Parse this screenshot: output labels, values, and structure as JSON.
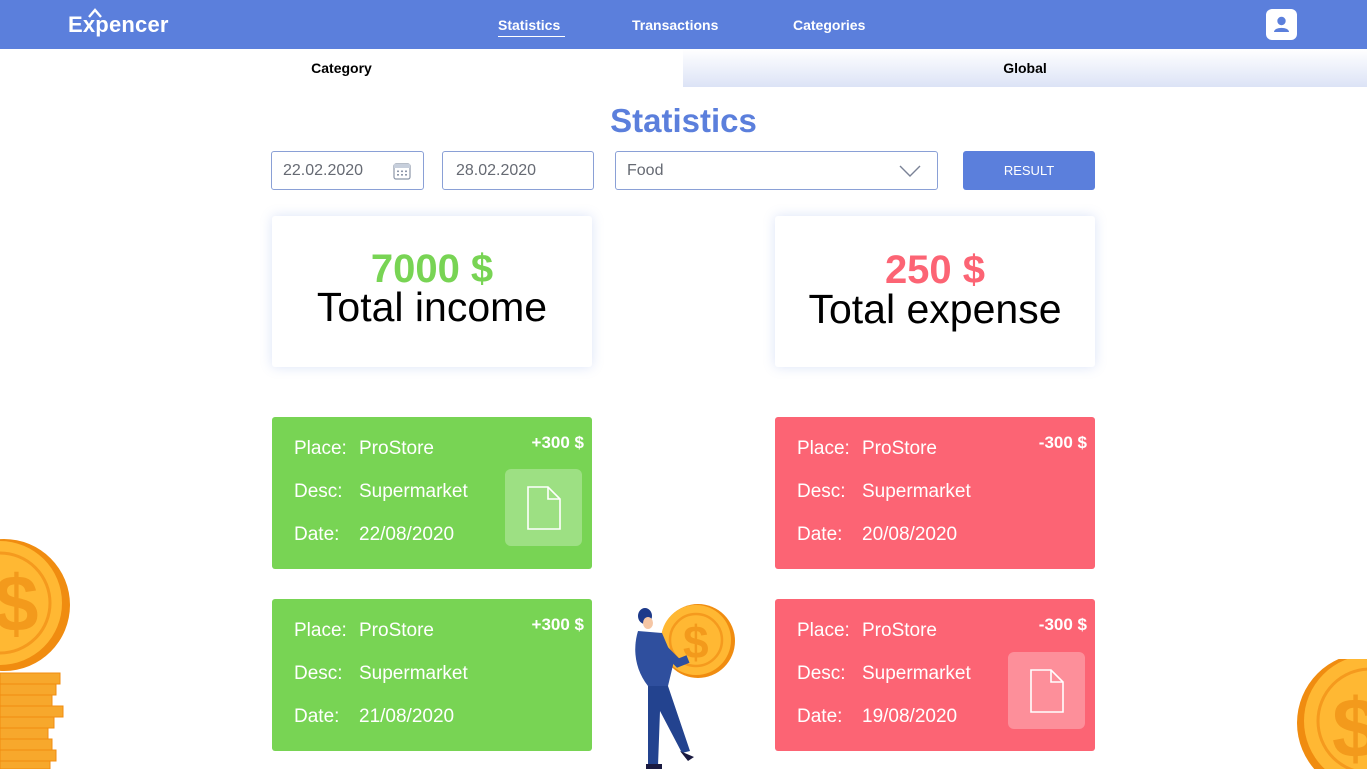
{
  "app": {
    "logo": "Expencer"
  },
  "nav": {
    "statistics": "Statistics",
    "transactions": "Transactions",
    "categories": "Categories",
    "active": "Statistics"
  },
  "tabs": {
    "category": "Category",
    "global": "Global"
  },
  "page": {
    "title": "Statistics"
  },
  "filters": {
    "date_from": "22.02.2020",
    "date_to": "28.02.2020",
    "category": "Food",
    "result_label": "RESULT"
  },
  "summary": {
    "income": {
      "amount": "7000 $",
      "label": "Total income"
    },
    "expense": {
      "amount": "250 $",
      "label": "Total expense"
    }
  },
  "labels": {
    "place": "Place:",
    "desc": "Desc:",
    "date": "Date:"
  },
  "transactions": [
    {
      "type": "income",
      "amount": "+300 $",
      "place": "ProStore",
      "desc": "Supermarket",
      "date": "22/08/2020",
      "has_receipt": true
    },
    {
      "type": "expense",
      "amount": "-300 $",
      "place": "ProStore",
      "desc": "Supermarket",
      "date": "20/08/2020",
      "has_receipt": false
    },
    {
      "type": "income",
      "amount": "+300 $",
      "place": "ProStore",
      "desc": "Supermarket",
      "date": "21/08/2020",
      "has_receipt": false
    },
    {
      "type": "expense",
      "amount": "-300 $",
      "place": "ProStore",
      "desc": "Supermarket",
      "date": "19/08/2020",
      "has_receipt": true
    }
  ],
  "colors": {
    "primary": "#5b7fdc",
    "income": "#78d454",
    "expense": "#fc6474",
    "coin": "#ffb833"
  },
  "icons": {
    "user": "user-icon",
    "calendar": "calendar-icon",
    "dropdown": "chevron-down-icon",
    "receipt": "document-icon"
  }
}
